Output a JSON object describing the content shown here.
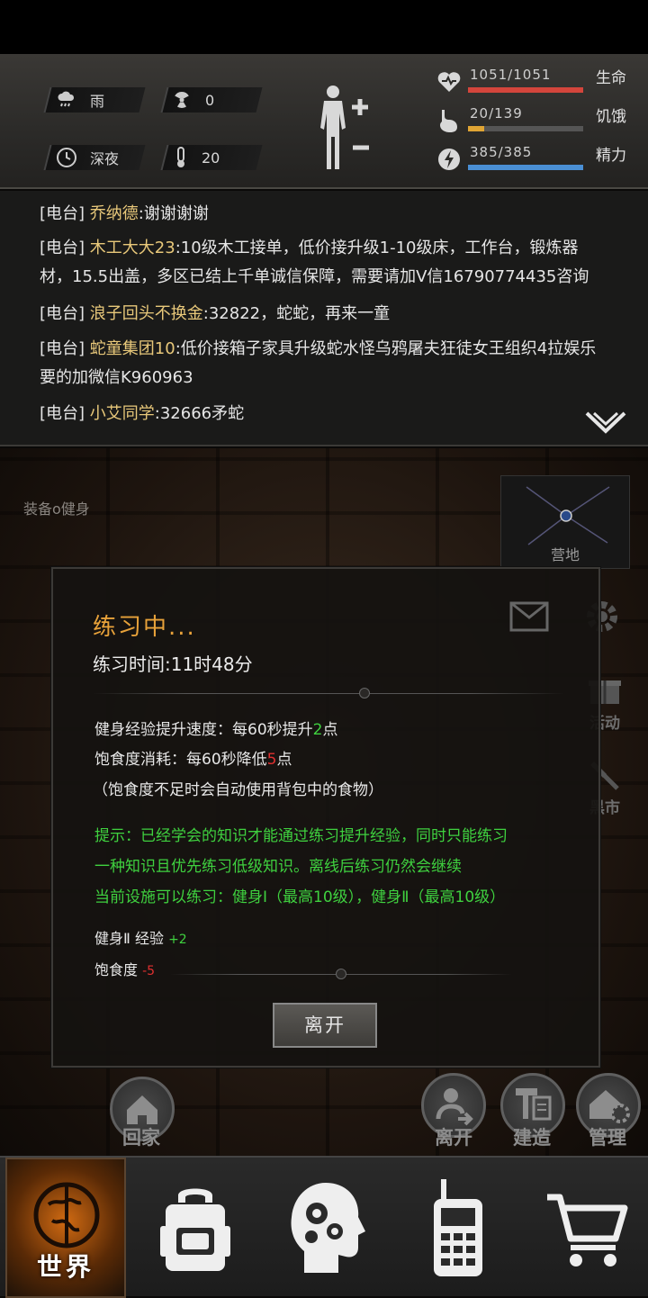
{
  "status": {
    "weather": "雨",
    "radiation": "0",
    "time_of_day": "深夜",
    "temperature": "20",
    "health": {
      "value": "1051/1051",
      "label": "生命",
      "fraction": 1.0,
      "color": "#d4453c"
    },
    "hunger": {
      "value": "20/139",
      "label": "饥饿",
      "fraction": 0.14,
      "color": "#e0a534"
    },
    "energy": {
      "value": "385/385",
      "label": "精力",
      "fraction": 1.0,
      "color": "#4a8fd4"
    }
  },
  "chat": {
    "messages": [
      {
        "channel": "[电台]",
        "name": "乔纳德",
        "text": ":谢谢谢谢"
      },
      {
        "channel": "[电台]",
        "name": "木工大大23",
        "text": ":10级木工接单，低价接升级1-10级床，工作台，锻炼器材，15.5出盖，多区已结上千单诚信保障，需要请加V信16790774435咨询"
      },
      {
        "channel": "[电台]",
        "name": "浪子回头不换金",
        "text": ":32822，蛇蛇，再来一童"
      },
      {
        "channel": "[电台]",
        "name": "蛇童集团10",
        "text": ":低价接箱子家具升级蛇水怪乌鸦屠夫狂徒女王组织4拉娱乐 要的加微信K960963"
      },
      {
        "channel": "[电台]",
        "name": "小艾同学",
        "text": ":32666矛蛇"
      }
    ]
  },
  "scene": {
    "equip_label": "装备o健身",
    "minimap_label": "营地",
    "side_buttons": [
      "活动",
      "黑市"
    ]
  },
  "dialog": {
    "title": "练习中...",
    "time": "练习时间:11时48分",
    "exp_prefix": "健身经验提升速度：每60秒提升",
    "exp_value": "2",
    "exp_suffix": "点",
    "hunger_prefix": "饱食度消耗：每60秒降低",
    "hunger_value": "5",
    "hunger_suffix": "点",
    "note": "（饱食度不足时会自动使用背包中的食物）",
    "tip_lines": [
      "提示：已经学会的知识才能通过练习提升经验，同时只能练习",
      "一种知识且优先练习低级知识。离线后练习仍然会继续",
      "当前设施可以练习：健身Ⅰ（最高10级），健身Ⅱ（最高10级）"
    ],
    "gain_label": "健身Ⅱ 经验",
    "gain_value": "+2",
    "loss_label": "饱食度",
    "loss_value": "-5",
    "leave_button": "离开"
  },
  "actions": {
    "home": "回家",
    "leave": "离开",
    "build": "建造",
    "manage": "管理"
  },
  "nav": {
    "world": "世界"
  }
}
